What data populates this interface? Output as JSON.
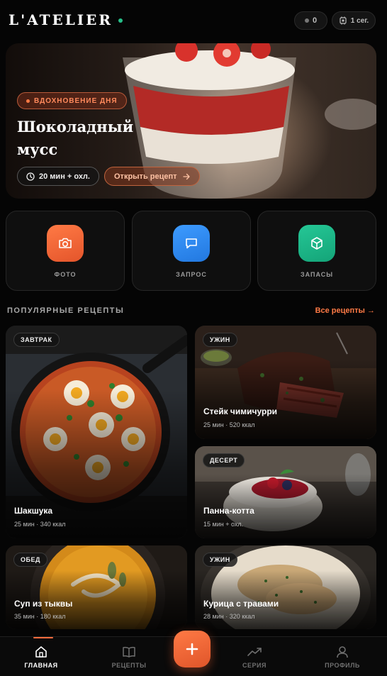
{
  "header": {
    "logo": "L'ATELIER",
    "count": "0",
    "date": "1 сег."
  },
  "hero": {
    "badge": "ВДОХНОВЕНИЕ ДНЯ",
    "title": "Шоколадный мусс",
    "time": "20 мин + охл.",
    "open_label": "Открыть рецепт"
  },
  "quick_actions": [
    {
      "label": "ФОТО",
      "icon": "camera-icon",
      "color": "#ff6b3d"
    },
    {
      "label": "ЗАПРОС",
      "icon": "chat-icon",
      "color": "#2f8cf0"
    },
    {
      "label": "ЗАПАСЫ",
      "icon": "box-icon",
      "color": "#1fb98a"
    }
  ],
  "popular": {
    "title": "ПОПУЛЯРНЫЕ РЕЦЕПТЫ",
    "link": "Все рецепты →"
  },
  "recipes": [
    {
      "tag": "ЗАВТРАК",
      "title": "Шакшука",
      "meta": "25 мин · 340 ккал"
    },
    {
      "tag": "УЖИН",
      "title": "Стейк чимичурри",
      "meta": "25 мин · 520 ккал"
    },
    {
      "tag": "ДЕСЕРТ",
      "title": "Панна-котта",
      "meta": "15 мин + охл."
    },
    {
      "tag": "ОБЕД",
      "title": "Суп из тыквы",
      "meta": "35 мин · 180 ккал"
    },
    {
      "tag": "УЖИН",
      "title": "Курица с травами",
      "meta": "28 мин · 320 ккал"
    }
  ],
  "nav": {
    "home": "ГЛАВНАЯ",
    "recipes": "РЕЦЕПТЫ",
    "series": "СЕРИЯ",
    "profile": "ПРОФИЛЬ",
    "fab": "+"
  },
  "colors": {
    "accent": "#ff6b3d",
    "online": "#27c08a"
  }
}
